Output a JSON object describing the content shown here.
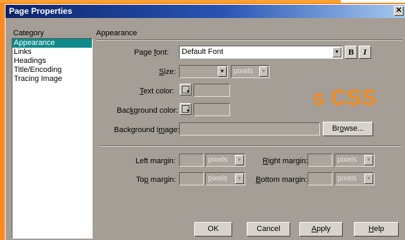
{
  "window": {
    "title": "Page Properties",
    "close_glyph": "✕"
  },
  "category": {
    "header": "Category",
    "items": [
      {
        "label": "Appearance",
        "selected": true
      },
      {
        "label": "Links",
        "selected": false
      },
      {
        "label": "Headings",
        "selected": false
      },
      {
        "label": "Title/Encoding",
        "selected": false
      },
      {
        "label": "Tracing Image",
        "selected": false
      }
    ]
  },
  "section": {
    "title": "Appearance"
  },
  "form": {
    "page_font": {
      "label_pre": "Page ",
      "label_key": "f",
      "label_post": "ont:",
      "value": "Default Font",
      "bold": "B",
      "italic": "I"
    },
    "size": {
      "label_key": "S",
      "label_post": "ize:",
      "value": "",
      "unit": "pixels"
    },
    "text_color": {
      "label_key": "T",
      "label_post": "ext color:",
      "value": ""
    },
    "background_color": {
      "label_pre": "Bac",
      "label_key": "k",
      "label_post": "ground color:",
      "value": ""
    },
    "background_image": {
      "label_pre": "Background i",
      "label_key": "m",
      "label_post": "age:",
      "value": "",
      "browse_pre": "Br",
      "browse_key": "o",
      "browse_post": "wse..."
    },
    "left_margin": {
      "label_pre": "Left margin:",
      "value": "",
      "unit": "pixels"
    },
    "right_margin": {
      "label_key": "R",
      "label_post": "ight margin:",
      "value": "",
      "unit": "pixels"
    },
    "top_margin": {
      "label_pre": "To",
      "label_key": "p",
      "label_post": " margin:",
      "value": "",
      "unit": "pixels"
    },
    "bottom_margin": {
      "label_key": "B",
      "label_post": "ottom margin:",
      "value": "",
      "unit": "pixels"
    }
  },
  "buttons": {
    "ok": "OK",
    "cancel": "Cancel",
    "apply_key": "A",
    "apply_post": "pply",
    "help_key": "H",
    "help_post": "elp"
  },
  "overlay_text": "s CSS",
  "colors": {
    "dialog_bg": "#a49e97",
    "selection": "#0f8a8c",
    "watermark": "#f28c1e",
    "titlebar": "#0a246a"
  }
}
